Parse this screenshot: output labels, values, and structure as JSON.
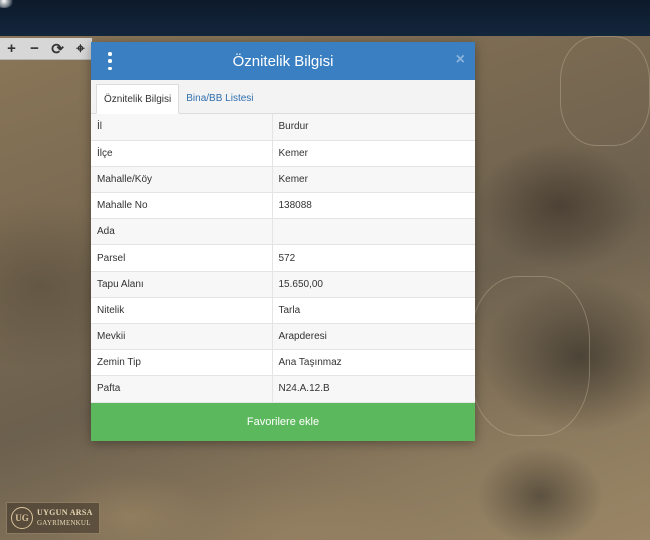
{
  "map": {
    "toolbar": {
      "zoom_in": "+",
      "zoom_out": "−",
      "refresh": "⟳",
      "locate": "⌖"
    }
  },
  "logo": {
    "line1": "UYGUN ARSA",
    "line2": "GAYRİMENKUL",
    "mark": "UG"
  },
  "modal": {
    "title": "Öznitelik Bilgisi",
    "close": "×",
    "tabs": [
      {
        "label": "Öznitelik Bilgisi",
        "active": true
      },
      {
        "label": "Bina/BB Listesi",
        "active": false
      }
    ],
    "rows": [
      {
        "key": "İl",
        "value": "Burdur"
      },
      {
        "key": "İlçe",
        "value": "Kemer"
      },
      {
        "key": "Mahalle/Köy",
        "value": "Kemer"
      },
      {
        "key": "Mahalle No",
        "value": "138088"
      },
      {
        "key": "Ada",
        "value": ""
      },
      {
        "key": "Parsel",
        "value": "572"
      },
      {
        "key": "Tapu Alanı",
        "value": "15.650,00"
      },
      {
        "key": "Nitelik",
        "value": "Tarla"
      },
      {
        "key": "Mevkii",
        "value": "Arapderesi"
      },
      {
        "key": "Zemin Tip",
        "value": "Ana Taşınmaz"
      },
      {
        "key": "Pafta",
        "value": "N24.A.12.B"
      }
    ],
    "favorite_button": "Favorilere ekle"
  },
  "colors": {
    "header": "#3a7fc2",
    "favorite": "#5cb85c",
    "topbar": "#0c1a2b"
  }
}
